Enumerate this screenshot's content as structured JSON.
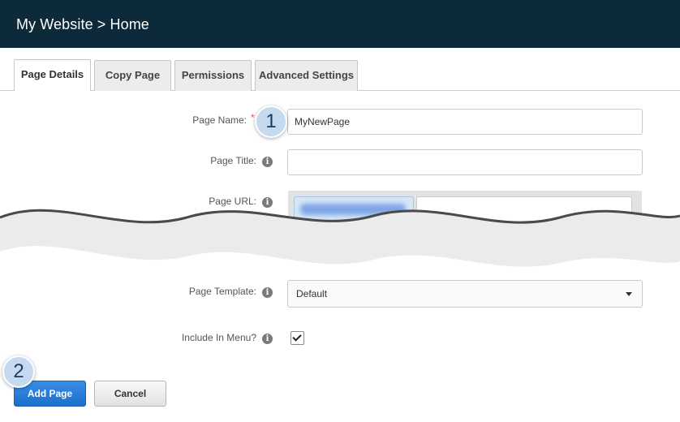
{
  "header": {
    "breadcrumb": "My Website > Home"
  },
  "tabs": [
    {
      "label": "Page Details",
      "active": true
    },
    {
      "label": "Copy Page",
      "active": false
    },
    {
      "label": "Permissions",
      "active": false
    },
    {
      "label": "Advanced Settings",
      "active": false
    }
  ],
  "form": {
    "page_name": {
      "label": "Page Name:",
      "required_mark": "*",
      "value": "MyNewPage"
    },
    "page_title": {
      "label": "Page Title:",
      "value": ""
    },
    "page_url": {
      "label": "Page URL:",
      "value": ""
    },
    "page_template": {
      "label": "Page Template:",
      "selected": "Default"
    },
    "include_in_menu": {
      "label": "Include In Menu?",
      "checked": true
    }
  },
  "buttons": {
    "add_label": "Add Page",
    "cancel_label": "Cancel"
  },
  "callouts": {
    "step1": "1",
    "step2": "2"
  },
  "icons": {
    "info": "info-icon",
    "caret": "chevron-down-icon",
    "check": "checkmark-icon"
  },
  "colors": {
    "header_bg": "#0d2a3a",
    "primary_button": "#1c6fcc",
    "required": "#d9534f",
    "callout_bg": "#c5d9ef"
  }
}
